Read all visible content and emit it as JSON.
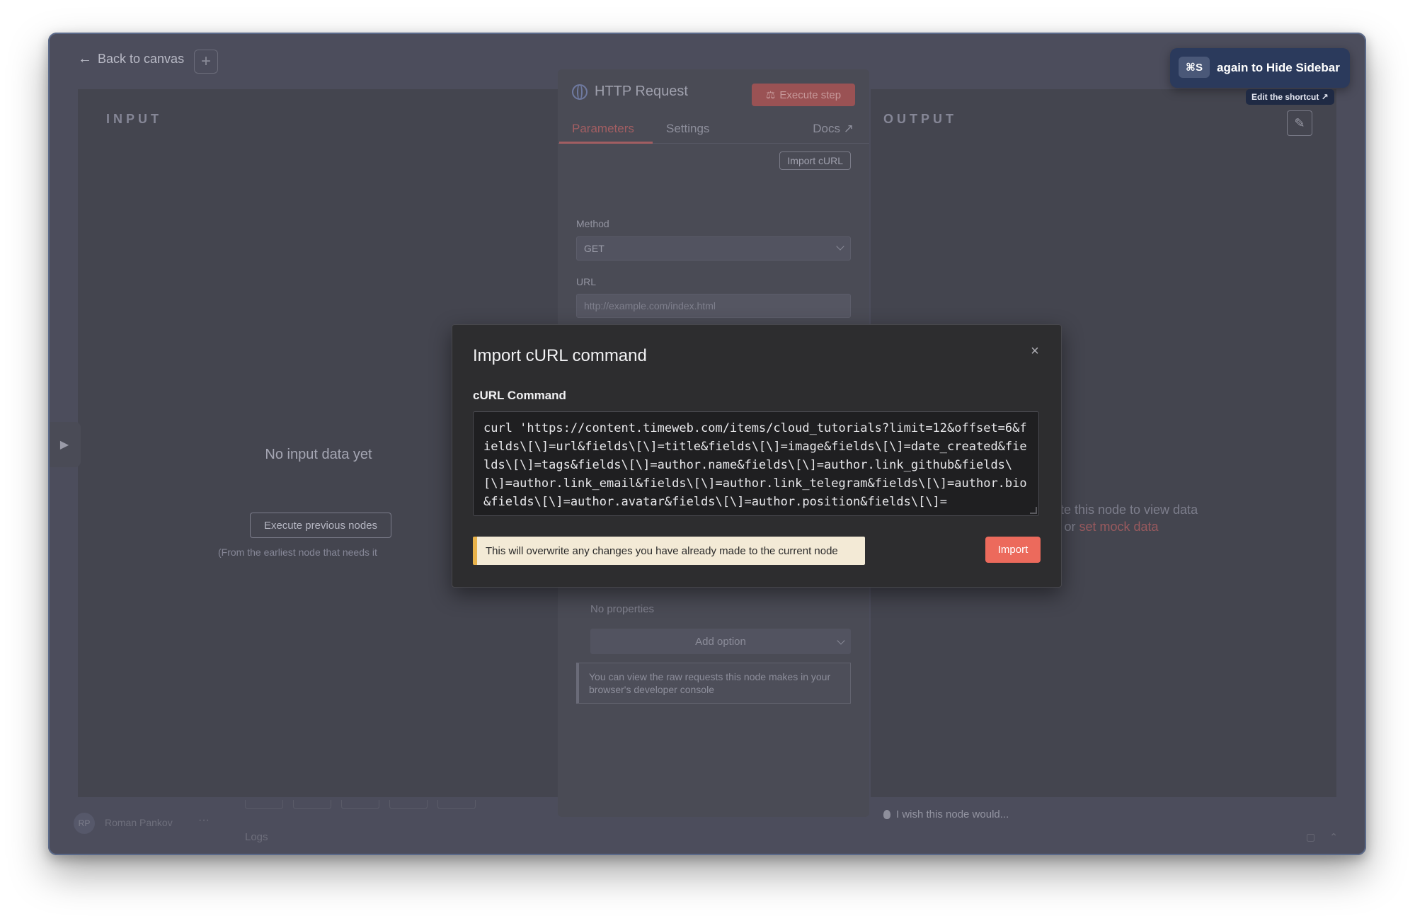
{
  "header": {
    "back_label": "Back to canvas",
    "plus_label": "+"
  },
  "input_panel": {
    "label": "INPUT",
    "empty_title": "No input data yet",
    "execute_previous_label": "Execute previous nodes",
    "earliest_note": "(From the earliest node that needs it"
  },
  "output_panel": {
    "label": "OUTPUT",
    "execute_line": "Execute this node to view data",
    "or_text": "or",
    "mock_link": "set mock data"
  },
  "node": {
    "title": "HTTP Request",
    "execute_step_label": "Execute step",
    "tabs": [
      {
        "label": "Parameters",
        "active": true
      },
      {
        "label": "Settings",
        "active": false
      }
    ],
    "docs_label": "Docs",
    "import_curl_label": "Import cURL",
    "method_label": "Method",
    "method_value": "GET",
    "url_label": "URL",
    "url_placeholder": "http://example.com/index.html",
    "no_properties": "No properties",
    "add_option_label": "Add option",
    "info_note": "You can view the raw requests this node makes in your browser's developer console"
  },
  "bottom": {
    "avatar_initials": "RP",
    "user_name": "Roman Pankov",
    "user_more": "···",
    "logs_label": "Logs",
    "wish_text": "I wish this node would..."
  },
  "toast": {
    "shortcut": "⌘S",
    "text": "again to Hide Sidebar",
    "edit_label": "Edit the shortcut ↗"
  },
  "modal": {
    "title": "Import cURL command",
    "close_icon": "×",
    "field_label": "cURL Command",
    "curl_value": "curl 'https://content.timeweb.com/items/cloud_tutorials?limit=12&offset=6&fields\\[\\]=url&fields\\[\\]=title&fields\\[\\]=image&fields\\[\\]=date_created&fields\\[\\]=tags&fields\\[\\]=author.name&fields\\[\\]=author.link_github&fields\\[\\]=author.link_email&fields\\[\\]=author.link_telegram&fields\\[\\]=author.bio&fields\\[\\]=author.avatar&fields\\[\\]=author.position&fields\\[\\]=",
    "warning": "This will overwrite any changes you have already made to the current node",
    "import_label": "Import"
  },
  "colors": {
    "accent": "#ec6a5c",
    "warning_border": "#e8b24a",
    "toast_bg": "#2b3a5c"
  }
}
